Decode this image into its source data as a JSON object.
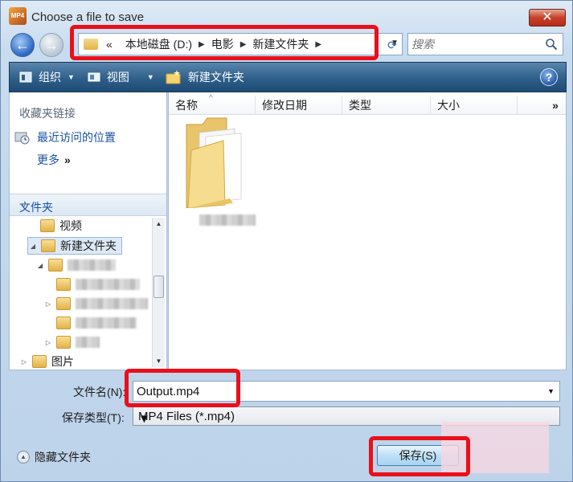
{
  "window": {
    "title": "Choose a file to save",
    "app_icon_text": "MP4",
    "close_symbol": "✕"
  },
  "nav": {
    "back_symbol": "←",
    "forward_symbol": "→",
    "breadcrumb_prefix": "«",
    "breadcrumb": [
      "本地磁盘 (D:)",
      "电影",
      "新建文件夹"
    ],
    "search_placeholder": "搜索"
  },
  "toolbar": {
    "organize_label": "组织",
    "views_label": "视图",
    "new_folder_label": "新建文件夹",
    "help_symbol": "?"
  },
  "sidebar": {
    "favorites_header": "收藏夹链接",
    "recent_places": "最近访问的位置",
    "more": "更多",
    "more_chevron": "»",
    "folders_header": "文件夹",
    "folders_header_chevron": "⌄",
    "tree": [
      {
        "label": "视频",
        "expander": ""
      },
      {
        "label": "新建文件夹",
        "expander": "◢"
      },
      {
        "label": "",
        "expander": "◢"
      },
      {
        "label": "",
        "expander": ""
      },
      {
        "label": "",
        "expander": "▷"
      },
      {
        "label": "",
        "expander": ""
      },
      {
        "label": "",
        "expander": "▷"
      },
      {
        "label": "图片",
        "expander": "▷"
      }
    ]
  },
  "file_list": {
    "columns": [
      "名称",
      "修改日期",
      "类型",
      "大小"
    ],
    "more_columns": "»",
    "sort_indicator": "^"
  },
  "save_form": {
    "filename_label": "文件名(N):",
    "filename_value": "Output.mp4",
    "filetype_label": "保存类型(T):",
    "filetype_value": "MP4 Files (*.mp4)",
    "hide_folders_label": "隐藏文件夹",
    "save_button": "保存(S)"
  },
  "colors": {
    "highlight_red": "#ea0f1a",
    "command_bar": "#2e5f8a",
    "link_blue": "#1a52a0"
  }
}
